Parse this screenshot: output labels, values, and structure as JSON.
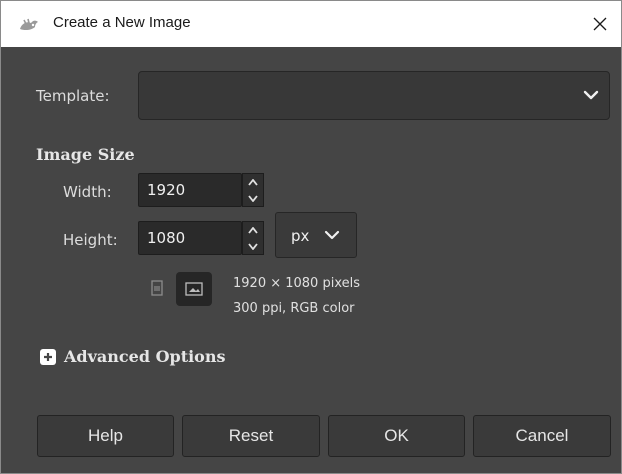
{
  "window": {
    "title": "Create a New Image",
    "close_icon": "close-icon",
    "app_icon": "gimp-wilber-icon"
  },
  "template": {
    "label": "Template:",
    "value": "",
    "icon": "chevron-down-icon"
  },
  "image_size": {
    "heading": "Image Size",
    "width_label": "Width:",
    "width_value": "1920",
    "height_label": "Height:",
    "height_value": "1080",
    "unit": "px",
    "orientation_selected": "landscape",
    "info_dimensions": "1920 × 1080 pixels",
    "info_resolution": "300 ppi, RGB color"
  },
  "advanced": {
    "label": "Advanced Options",
    "expanded": false,
    "icon": "plus-icon"
  },
  "buttons": {
    "help": "Help",
    "reset": "Reset",
    "ok": "OK",
    "cancel": "Cancel"
  },
  "colors": {
    "dialog_bg": "#454545",
    "titlebar_bg": "#ffffff",
    "entry_bg": "#2a2a2a",
    "button_bg": "#3a3a3a",
    "text": "#e6e6e6"
  }
}
